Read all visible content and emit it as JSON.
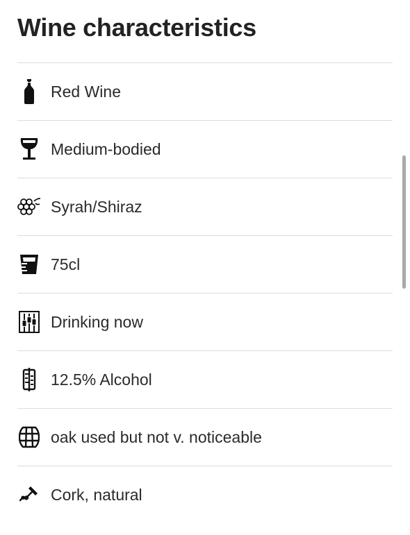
{
  "header": {
    "title": "Wine characteristics"
  },
  "characteristics": [
    {
      "icon": "wine-bottle-icon",
      "label": "Red Wine"
    },
    {
      "icon": "wine-glass-icon",
      "label": "Medium-bodied"
    },
    {
      "icon": "grapes-icon",
      "label": "Syrah/Shiraz"
    },
    {
      "icon": "measuring-cup-icon",
      "label": "75cl"
    },
    {
      "icon": "wine-rack-icon",
      "label": "Drinking now"
    },
    {
      "icon": "alcohol-gauge-icon",
      "label": "12.5% Alcohol"
    },
    {
      "icon": "oak-barrel-icon",
      "label": "oak used but not v. noticeable"
    },
    {
      "icon": "corkscrew-icon",
      "label": "Cork, natural"
    }
  ],
  "colors": {
    "text": "#2a2a2a",
    "divider": "#dcdcdc",
    "scrollbar": "#a9a9a9"
  }
}
